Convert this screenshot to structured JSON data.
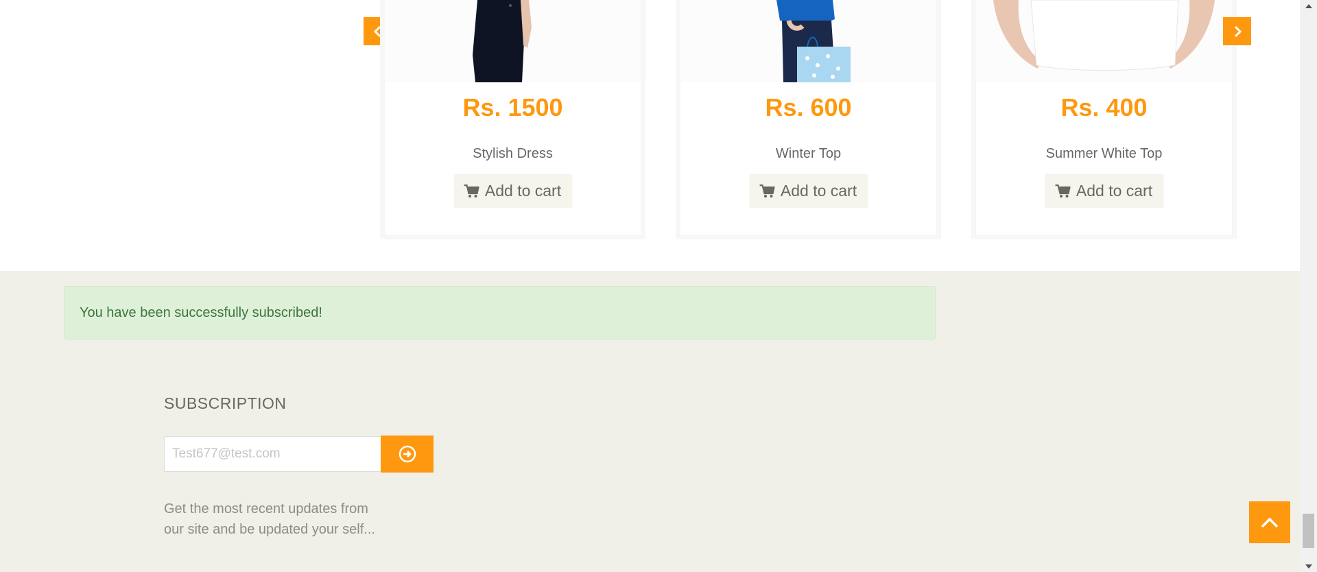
{
  "carousel": {
    "prev_icon": "chevron-left-icon",
    "next_icon": "chevron-right-icon",
    "products": [
      {
        "price": "Rs. 1500",
        "name": "Stylish Dress",
        "cart_label": "Add to cart"
      },
      {
        "price": "Rs. 600",
        "name": "Winter Top",
        "cart_label": "Add to cart"
      },
      {
        "price": "Rs. 400",
        "name": "Summer White Top",
        "cart_label": "Add to cart"
      }
    ]
  },
  "alert": {
    "message": "You have been successfully subscribed!"
  },
  "subscription": {
    "title": "SUBSCRIPTION",
    "email_placeholder": "Test677@test.com",
    "submit_icon": "arrow-circle-right-icon",
    "description_line1": "Get the most recent updates from",
    "description_line2": "our site and be updated your self..."
  },
  "scroll_up_icon": "chevron-up-icon",
  "colors": {
    "accent": "#fe980f",
    "footer_bg": "#f0f0e9",
    "alert_bg": "#dff0d8",
    "alert_text": "#3c763d",
    "text_gray": "#696763"
  }
}
